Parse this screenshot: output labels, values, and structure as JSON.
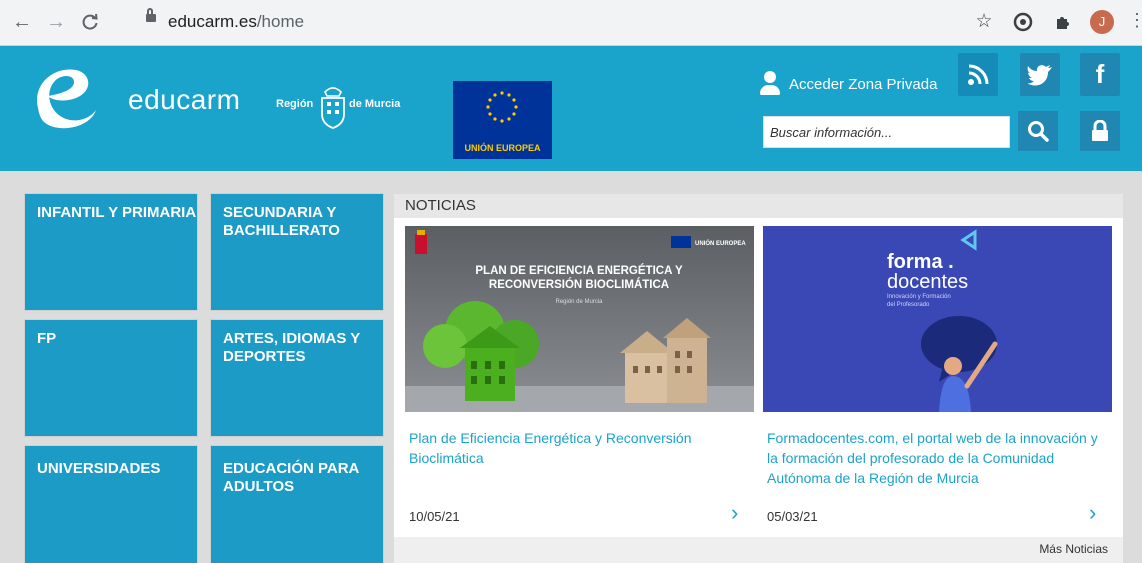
{
  "browser": {
    "url_host": "educarm.es",
    "url_path": "/home",
    "avatar_letter": "J"
  },
  "header": {
    "brand": "educarm",
    "region_left": "Región",
    "region_right": "de Murcia",
    "eu_label": "UNIÓN EUROPEA",
    "acceder": "Acceder Zona Privada",
    "search_placeholder": "Buscar información..."
  },
  "tiles": [
    {
      "label": "INFANTIL Y PRIMARIA"
    },
    {
      "label": "SECUNDARIA Y BACHILLERATO"
    },
    {
      "label": "FP"
    },
    {
      "label": "ARTES, IDIOMAS Y DEPORTES"
    },
    {
      "label": "UNIVERSIDADES"
    },
    {
      "label": "EDUCACIÓN PARA ADULTOS"
    }
  ],
  "news": {
    "heading": "NOTICIAS",
    "more": "Más Noticias",
    "items": [
      {
        "image_title": "PLAN DE EFICIENCIA ENERGÉTICA Y RECONVERSIÓN BIOCLIMÁTICA",
        "image_subtitle": "Región de Murcia",
        "image_badge": "UNIÓN EUROPEA",
        "title": "Plan de Eficiencia Energética y Reconversión Bioclimática",
        "date": "10/05/21"
      },
      {
        "image_title_1": "forma .",
        "image_title_2": "docentes",
        "image_tagline_1": "Innovación y Formación",
        "image_tagline_2": "del Profesorado",
        "title": "Formadocentes.com, el portal web de la innovación y la formación del profesorado de la Comunidad Autónoma de la Región de Murcia",
        "date": "05/03/21"
      }
    ]
  },
  "colors": {
    "header_blue": "#1aa3cb",
    "tile_blue": "#1b9bc6",
    "link_blue": "#1aa3cb",
    "eu_blue": "#003399"
  }
}
